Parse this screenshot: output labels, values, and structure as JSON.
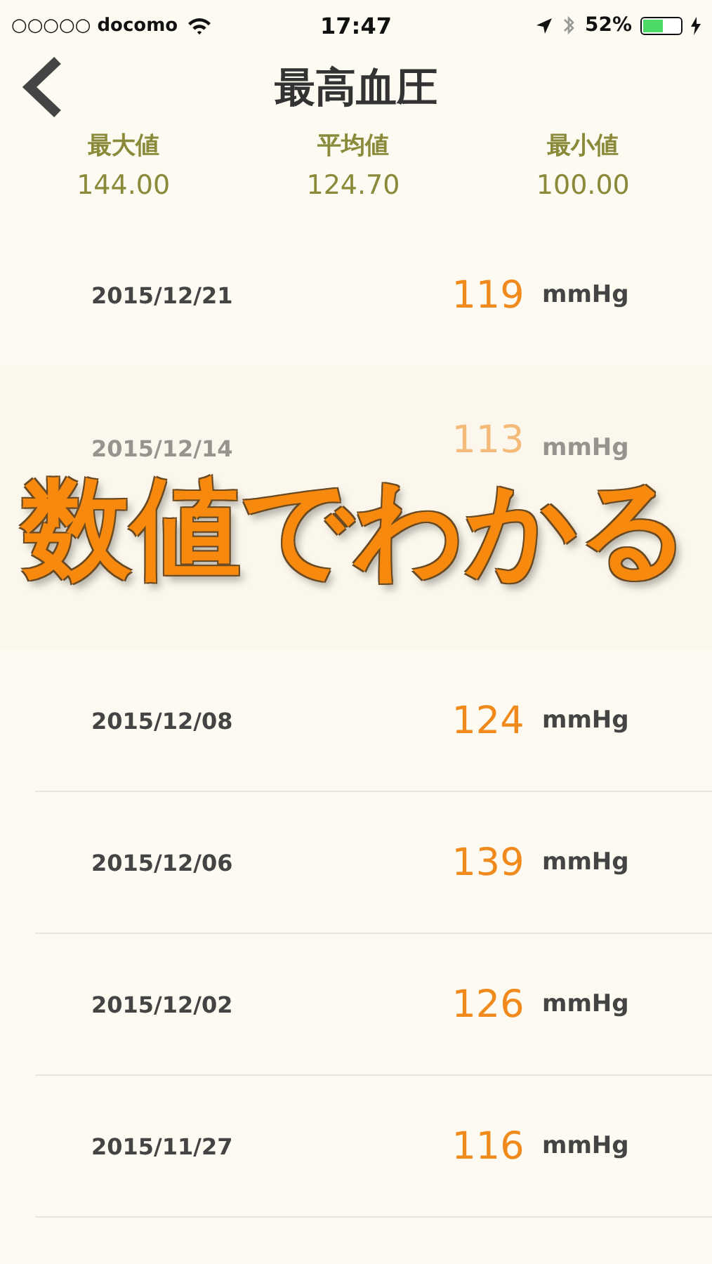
{
  "status_bar": {
    "carrier": "○○○○○ docomo",
    "time": "17:47",
    "battery": "52%",
    "battery_icon": {
      "level": 0.52
    }
  },
  "nav": {
    "title": "最高血圧"
  },
  "stats": [
    {
      "label": "最大値",
      "value": "144.00"
    },
    {
      "label": "平均値",
      "value": "124.70"
    },
    {
      "label": "最小値",
      "value": "100.00"
    }
  ],
  "rows_before": [
    {
      "date": "2015/12/21",
      "value": "119",
      "unit": "mmHg"
    }
  ],
  "overlay": {
    "caption": "数値でわかる",
    "faded_rows": [
      {
        "date": "2015/12/14",
        "value": "113",
        "unit": "mmHg"
      }
    ]
  },
  "rows_after": [
    {
      "date": "2015/12/08",
      "value": "124",
      "unit": "mmHg"
    },
    {
      "date": "2015/12/06",
      "value": "139",
      "unit": "mmHg"
    },
    {
      "date": "2015/12/02",
      "value": "126",
      "unit": "mmHg"
    },
    {
      "date": "2015/11/27",
      "value": "116",
      "unit": "mmHg"
    }
  ]
}
